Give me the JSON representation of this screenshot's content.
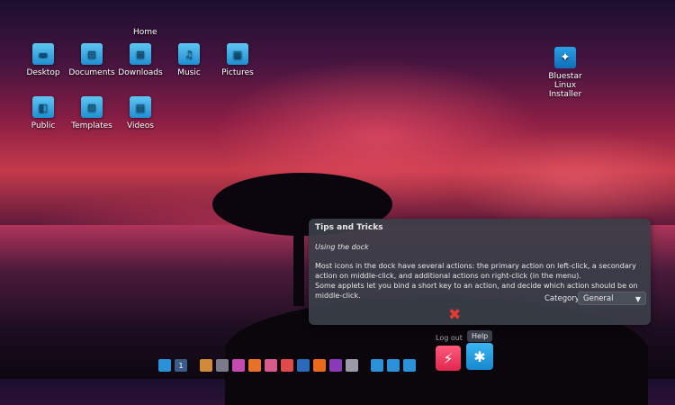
{
  "desktop": {
    "home_label": "Home",
    "icons": [
      {
        "label": "Desktop",
        "glyph": "▬"
      },
      {
        "label": "Documents",
        "glyph": "⊡"
      },
      {
        "label": "Downloads",
        "glyph": "⊞"
      },
      {
        "label": "Music",
        "glyph": "♫"
      },
      {
        "label": "Pictures",
        "glyph": "▣"
      },
      {
        "label": "Public",
        "glyph": "◧"
      },
      {
        "label": "Templates",
        "glyph": "⊡"
      },
      {
        "label": "Videos",
        "glyph": "▤"
      }
    ],
    "installer": {
      "label_line1": "Bluestar Linux",
      "label_line2": "Installer",
      "glyph": "✦"
    }
  },
  "tips": {
    "title": "Tips and Tricks",
    "subtitle": "Using the dock",
    "body_line1": "Most icons in the dock have several actions: the primary action on left-click, a secondary action on middle-click, and additional actions on right-click (in the menu).",
    "body_line2": "Some applets let you bind a short key to an action, and decide which action should be on middle-click.",
    "category_label": "Category",
    "category_value": "General",
    "close_glyph": "✖"
  },
  "dock": {
    "logout_label": "Log out",
    "help_label": "Help",
    "workspace_number": "1",
    "colors": {
      "accent_blue": "#1e8fd6",
      "logout_red": "#ff3d68",
      "help_blue": "#2aa3e6"
    }
  }
}
